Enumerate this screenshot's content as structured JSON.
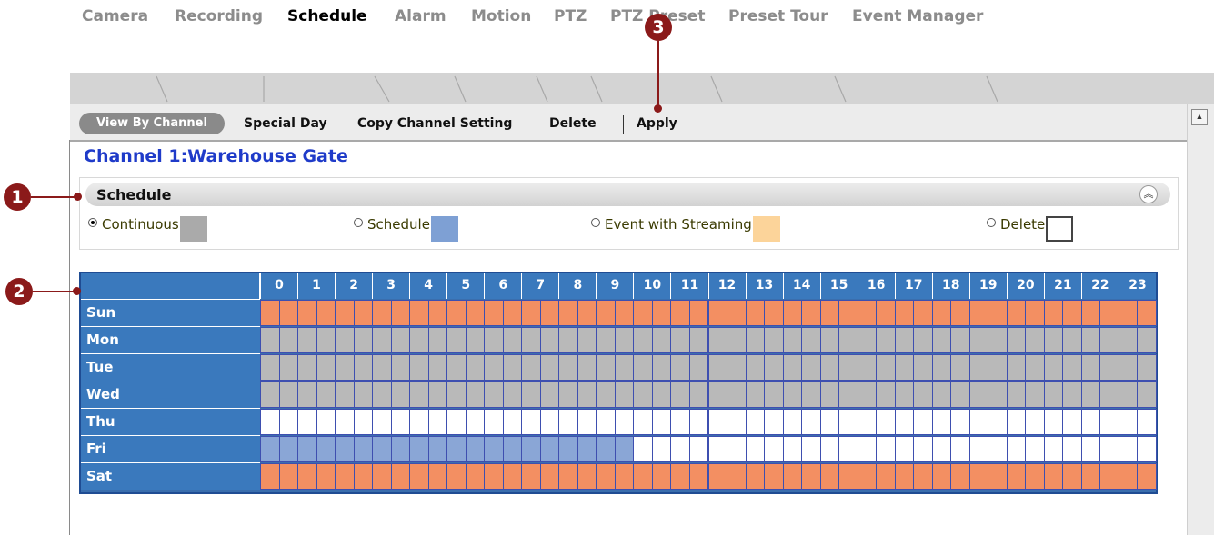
{
  "tabs": [
    {
      "label": "Camera",
      "active": false
    },
    {
      "label": "Recording",
      "active": false
    },
    {
      "label": "Schedule",
      "active": true
    },
    {
      "label": "Alarm",
      "active": false
    },
    {
      "label": "Motion",
      "active": false
    },
    {
      "label": "PTZ",
      "active": false
    },
    {
      "label": "PTZ Preset",
      "active": false
    },
    {
      "label": "Preset Tour",
      "active": false
    },
    {
      "label": "Event Manager",
      "active": false
    }
  ],
  "subnav": {
    "view_by_channel": "View By Channel",
    "special_day": "Special Day",
    "copy_channel_setting": "Copy Channel Setting",
    "delete": "Delete",
    "apply": "Apply"
  },
  "channel_title": "Channel 1:Warehouse Gate",
  "panel": {
    "title": "Schedule",
    "collapse_icon": "double-chevron-up-icon",
    "options": [
      {
        "label": "Continuous",
        "selected": true,
        "color": "#aaaaaa"
      },
      {
        "label": "Schedule",
        "selected": false,
        "color": "#7ea0d4"
      },
      {
        "label": "Event with Streaming",
        "selected": false,
        "color": "#fcd49a"
      },
      {
        "label": "Delete",
        "selected": false,
        "color": "#ffffff"
      }
    ]
  },
  "grid": {
    "hours": [
      "0",
      "1",
      "2",
      "3",
      "4",
      "5",
      "6",
      "7",
      "8",
      "9",
      "10",
      "11",
      "12",
      "13",
      "14",
      "15",
      "16",
      "17",
      "18",
      "19",
      "20",
      "21",
      "22",
      "23"
    ],
    "days": [
      {
        "label": "Sun",
        "blocks": [
          {
            "mode": "event",
            "from_hour": 0,
            "to_hour": 24
          }
        ]
      },
      {
        "label": "Mon",
        "blocks": [
          {
            "mode": "continuous",
            "from_hour": 0,
            "to_hour": 24
          }
        ]
      },
      {
        "label": "Tue",
        "blocks": [
          {
            "mode": "continuous",
            "from_hour": 0,
            "to_hour": 24
          }
        ]
      },
      {
        "label": "Wed",
        "blocks": [
          {
            "mode": "continuous",
            "from_hour": 0,
            "to_hour": 24
          }
        ]
      },
      {
        "label": "Thu",
        "blocks": [
          {
            "mode": "none",
            "from_hour": 0,
            "to_hour": 24
          }
        ]
      },
      {
        "label": "Fri",
        "blocks": [
          {
            "mode": "schedule",
            "from_hour": 0,
            "to_hour": 10
          },
          {
            "mode": "none",
            "from_hour": 10,
            "to_hour": 24
          }
        ]
      },
      {
        "label": "Sat",
        "blocks": [
          {
            "mode": "event",
            "from_hour": 0,
            "to_hour": 24
          }
        ]
      }
    ],
    "mode_colors": {
      "continuous": "#b9b9b9",
      "schedule": "#8aa6d6",
      "event": "#f38f62",
      "none": "#ffffff"
    }
  },
  "callouts": [
    "1",
    "2",
    "3"
  ]
}
